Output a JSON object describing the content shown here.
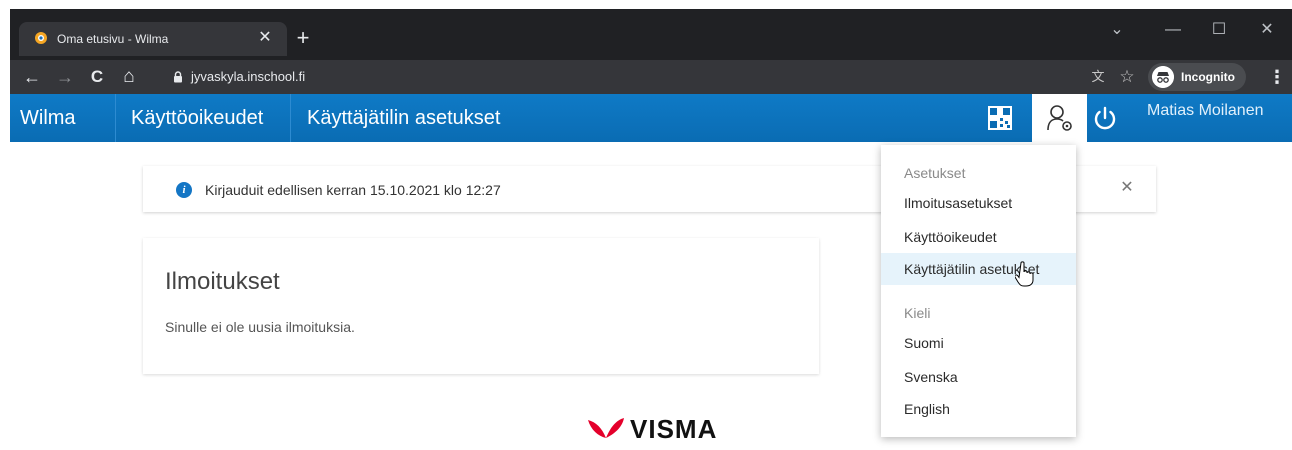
{
  "browser": {
    "tab_title": "Oma etusivu - Wilma",
    "tab_close": "✕",
    "new_tab": "+",
    "url": "jyvaskyla.inschool.fi",
    "incognito_label": "Incognito",
    "nav": {
      "back": "←",
      "forward": "→",
      "reload": "C",
      "home": "⌂"
    },
    "window_controls": {
      "dropdown": "⌄",
      "minimize": "—",
      "maximize": "☐",
      "close": "✕"
    },
    "toolbar_icons": {
      "translate": "文",
      "bookmark": "☆",
      "menu": "⋮"
    }
  },
  "wilma_nav": {
    "brand": "Wilma",
    "links": [
      "Käyttöoikeudet",
      "Käyttäjätilin asetukset"
    ],
    "user_name": "Matias Moilanen",
    "icons": [
      "qr-code-icon",
      "user-settings-icon",
      "power-icon"
    ]
  },
  "notice": {
    "icon": "i",
    "text": "Kirjauduit edellisen kerran 15.10.2021 klo 12:27",
    "close": "✕"
  },
  "notifications": {
    "title": "Ilmoitukset",
    "empty_text": "Sinulle ei ole uusia ilmoituksia."
  },
  "footer": {
    "logo_text": "VISMA"
  },
  "dropdown": {
    "settings_header": "Asetukset",
    "settings_items": [
      "Ilmoitusasetukset",
      "Käyttöoikeudet",
      "Käyttäjätilin asetukset"
    ],
    "language_header": "Kieli",
    "language_items": [
      "Suomi",
      "Svenska",
      "English"
    ],
    "hovered_item": "Käyttäjätilin asetukset"
  },
  "colors": {
    "nav_blue": "#0a6cb3",
    "chrome_dark": "#202124",
    "chrome_toolbar": "#35363a",
    "hover_bg": "#e6f3fb",
    "visma_red": "#e4002b"
  }
}
